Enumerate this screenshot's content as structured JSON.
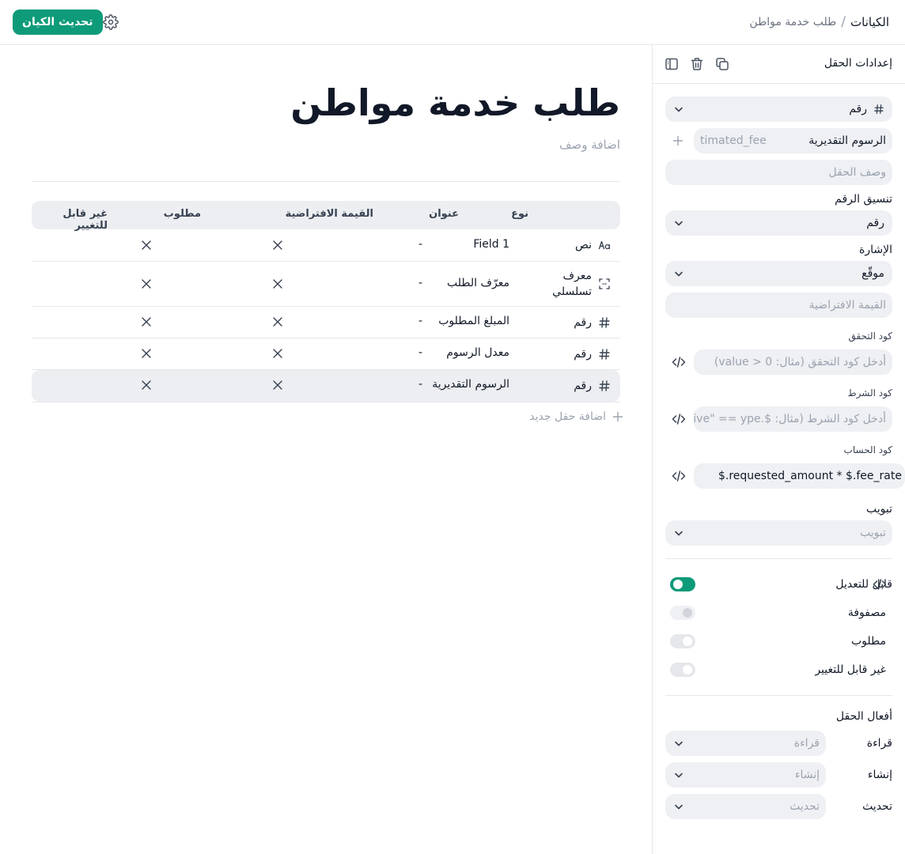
{
  "breadcrumb": {
    "root": "الكيانات",
    "separator": "/",
    "current": "طلب خدمة مواطن"
  },
  "topbar": {
    "update_button": "تحديث الكيان"
  },
  "entity": {
    "title": "طلب خدمة مواطن",
    "add_description": "اضافة وصف"
  },
  "table": {
    "headers": {
      "type": "نوع",
      "title": "عنوان",
      "default": "القيمة الافتراضية",
      "required": "مطلوب",
      "immutable": "غير قابل للتغيير"
    },
    "rows": [
      {
        "icon": "text-type-icon",
        "type": "نص",
        "title": "Field 1",
        "default": "-"
      },
      {
        "icon": "serial-id-icon",
        "type": "معرف تسلسلي",
        "title": "معرّف الطلب",
        "default": "-"
      },
      {
        "icon": "hash-icon",
        "type": "رقم",
        "title": "المبلغ المطلوب",
        "default": "-"
      },
      {
        "icon": "hash-icon",
        "type": "رقم",
        "title": "معدل الرسوم",
        "default": "-"
      },
      {
        "icon": "hash-icon",
        "type": "رقم",
        "title": "الرسوم التقديرية",
        "default": "-",
        "selected": true
      }
    ],
    "add_field": "اضافة حقل جديد"
  },
  "sidebar": {
    "title": "إعدادات الحقل",
    "field_type": "رقم",
    "field_label_value": "الرسوم التقديرية",
    "field_key_value": "timated_fee",
    "field_description_placeholder": "وصف الحقل",
    "number_format_label": "تنسيق الرقم",
    "number_format_value": "رقم",
    "sign_label": "الإشارة",
    "sign_value": "موقّع",
    "default_value_placeholder": "القيمة الافتراضية",
    "validation_code_label": "كود التحقق",
    "validation_code_placeholder": "أدخل كود التحقق (مثال: value > 0)",
    "condition_code_label": "كود الشرط",
    "condition_code_placeholder": "أدخل كود الشرط (مثال: $.active\" == ype/",
    "compute_code_label": "كود الحساب",
    "compute_code_value": "$.requested_amount * $.fee_rate",
    "tab_label": "تبويب",
    "tab_placeholder": "تبويب",
    "toggles": {
      "editable": "قابل للتعديل",
      "array": "مصفوفة",
      "required": "مطلوب",
      "immutable": "غير قابل للتغيير"
    },
    "actions_label": "أفعال الحقل",
    "actions": [
      {
        "label": "قراءة",
        "placeholder": "قراءة"
      },
      {
        "label": "إنشاء",
        "placeholder": "إنشاء"
      },
      {
        "label": "تحديث",
        "placeholder": "تحديث"
      }
    ]
  },
  "colors": {
    "accent": "#0e9b7a",
    "pill_bg": "#eef0f3",
    "header_bg": "#eceef1",
    "border": "#e5e7eb"
  }
}
